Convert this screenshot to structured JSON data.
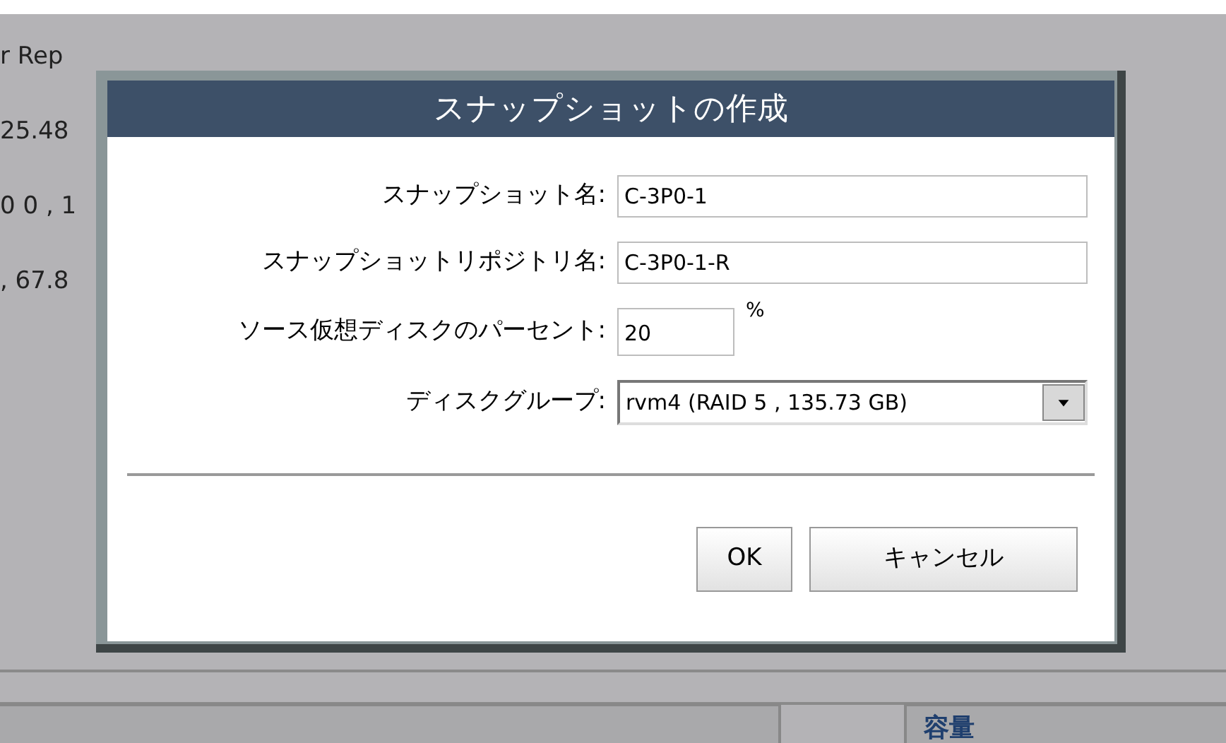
{
  "background": {
    "texts": [
      "r Rep",
      "25.48",
      "0 0 , 1",
      ", 67.8"
    ],
    "panel_heading": "容量"
  },
  "dialog": {
    "title": "スナップショットの作成",
    "fields": [
      {
        "kind": "text",
        "label": "スナップショット名:",
        "value": "C-3P0-1"
      },
      {
        "kind": "text",
        "label": "スナップショットリポジトリ名:",
        "value": "C-3P0-1-R"
      },
      {
        "kind": "percent",
        "label": "ソース仮想ディスクのパーセント:",
        "value": "20",
        "unit": "%"
      },
      {
        "kind": "select",
        "label": "ディスクグループ:",
        "value": "rvm4 (RAID 5 , 135.73 GB)"
      }
    ],
    "buttons": [
      "OK",
      "キャンセル"
    ]
  }
}
